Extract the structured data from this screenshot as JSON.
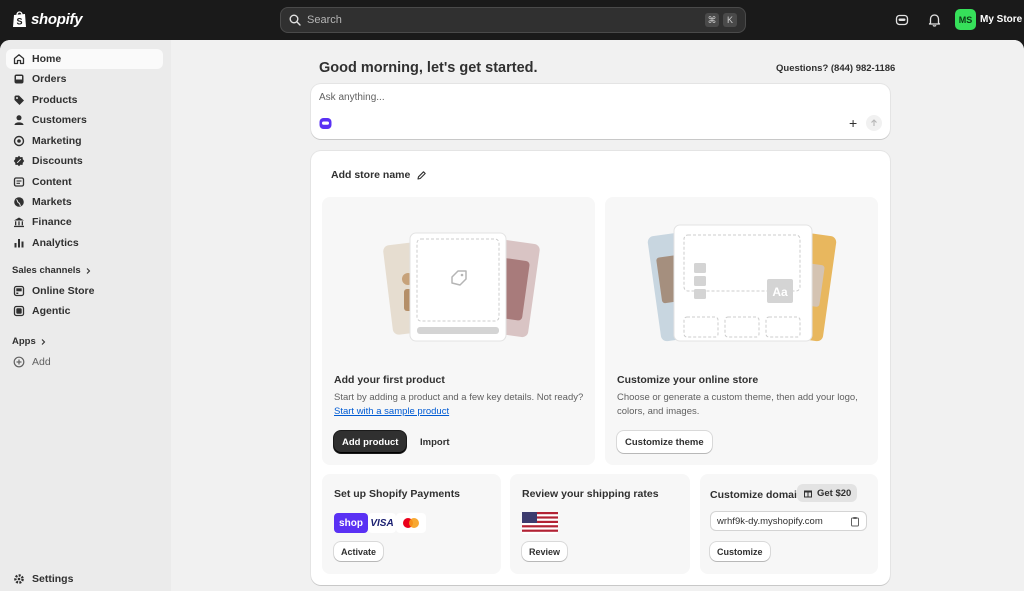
{
  "topbar": {
    "brand": "shopify",
    "search_placeholder": "Search",
    "shortcut_keys": [
      "⌘",
      "K"
    ],
    "store_initials": "MS",
    "store_name": "My Store"
  },
  "sidebar": {
    "items": [
      {
        "label": "Home",
        "icon": "home-icon"
      },
      {
        "label": "Orders",
        "icon": "inbox-icon"
      },
      {
        "label": "Products",
        "icon": "tag-icon"
      },
      {
        "label": "Customers",
        "icon": "person-icon"
      },
      {
        "label": "Marketing",
        "icon": "target-icon"
      },
      {
        "label": "Discounts",
        "icon": "discount-icon"
      },
      {
        "label": "Content",
        "icon": "content-icon"
      },
      {
        "label": "Markets",
        "icon": "globe-icon"
      },
      {
        "label": "Finance",
        "icon": "bank-icon"
      },
      {
        "label": "Analytics",
        "icon": "bar-chart-icon"
      }
    ],
    "sales_channels_label": "Sales channels",
    "channels": [
      {
        "label": "Online Store",
        "icon": "store-icon"
      },
      {
        "label": "Agentic",
        "icon": "agent-icon"
      }
    ],
    "apps_label": "Apps",
    "add_label": "Add",
    "settings_label": "Settings"
  },
  "main": {
    "greeting": "Good morning, let's get started.",
    "questions": "Questions? (844) 982-1186",
    "ask_placeholder": "Ask anything...",
    "store_name_label": "Add store name",
    "product_task": {
      "title": "Add your first product",
      "desc_before": "Start by adding a product and a few key details. Not ready? ",
      "desc_link": "Start with a sample product",
      "primary_label": "Add product",
      "secondary_label": "Import"
    },
    "theme_task": {
      "title": "Customize your online store",
      "desc": "Choose or generate a custom theme, then add your logo, colors, and images.",
      "button_label": "Customize theme",
      "font_preview": "Aa"
    },
    "payments": {
      "title": "Set up Shopify Payments",
      "badges": [
        "shop",
        "VISA"
      ],
      "button_label": "Activate"
    },
    "shipping": {
      "title": "Review your shipping rates",
      "button_label": "Review"
    },
    "domain": {
      "title": "Customize domain",
      "reward_label": "Get $20",
      "domain_value": "wrhf9k-dy.myshopify.com",
      "button_label": "Customize"
    }
  },
  "colors": {
    "topbar": "#1a1a1a",
    "avatar": "#36e05a",
    "shop_pay": "#5a31f4",
    "link": "#005bd3"
  }
}
